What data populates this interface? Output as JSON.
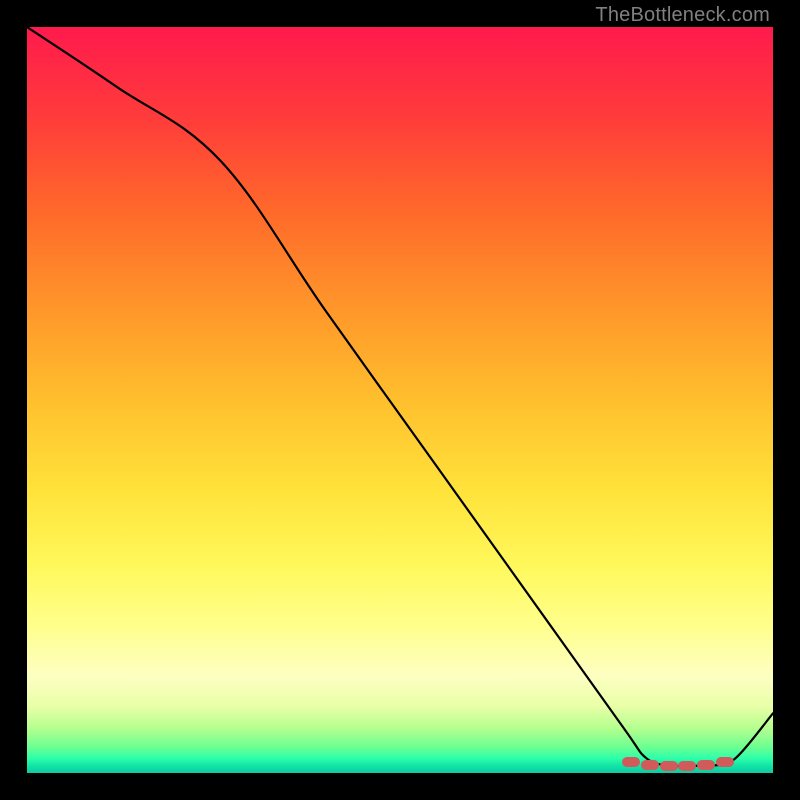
{
  "attribution": "TheBottleneck.com",
  "chart_data": {
    "type": "line",
    "title": "",
    "xlabel": "",
    "ylabel": "",
    "xlim": [
      0,
      1
    ],
    "ylim": [
      0,
      1
    ],
    "x": [
      0.0,
      0.12,
      0.26,
      0.4,
      0.55,
      0.7,
      0.8,
      0.83,
      0.86,
      0.89,
      0.92,
      0.95,
      1.0
    ],
    "values": [
      1.0,
      0.92,
      0.82,
      0.62,
      0.41,
      0.2,
      0.06,
      0.02,
      0.01,
      0.01,
      0.01,
      0.02,
      0.08
    ],
    "markers_x": [
      0.81,
      0.835,
      0.86,
      0.885,
      0.91,
      0.935
    ],
    "markers_y": [
      0.015,
      0.011,
      0.01,
      0.01,
      0.011,
      0.015
    ],
    "gradient_note": "vertical red→yellow→green heat gradient"
  }
}
